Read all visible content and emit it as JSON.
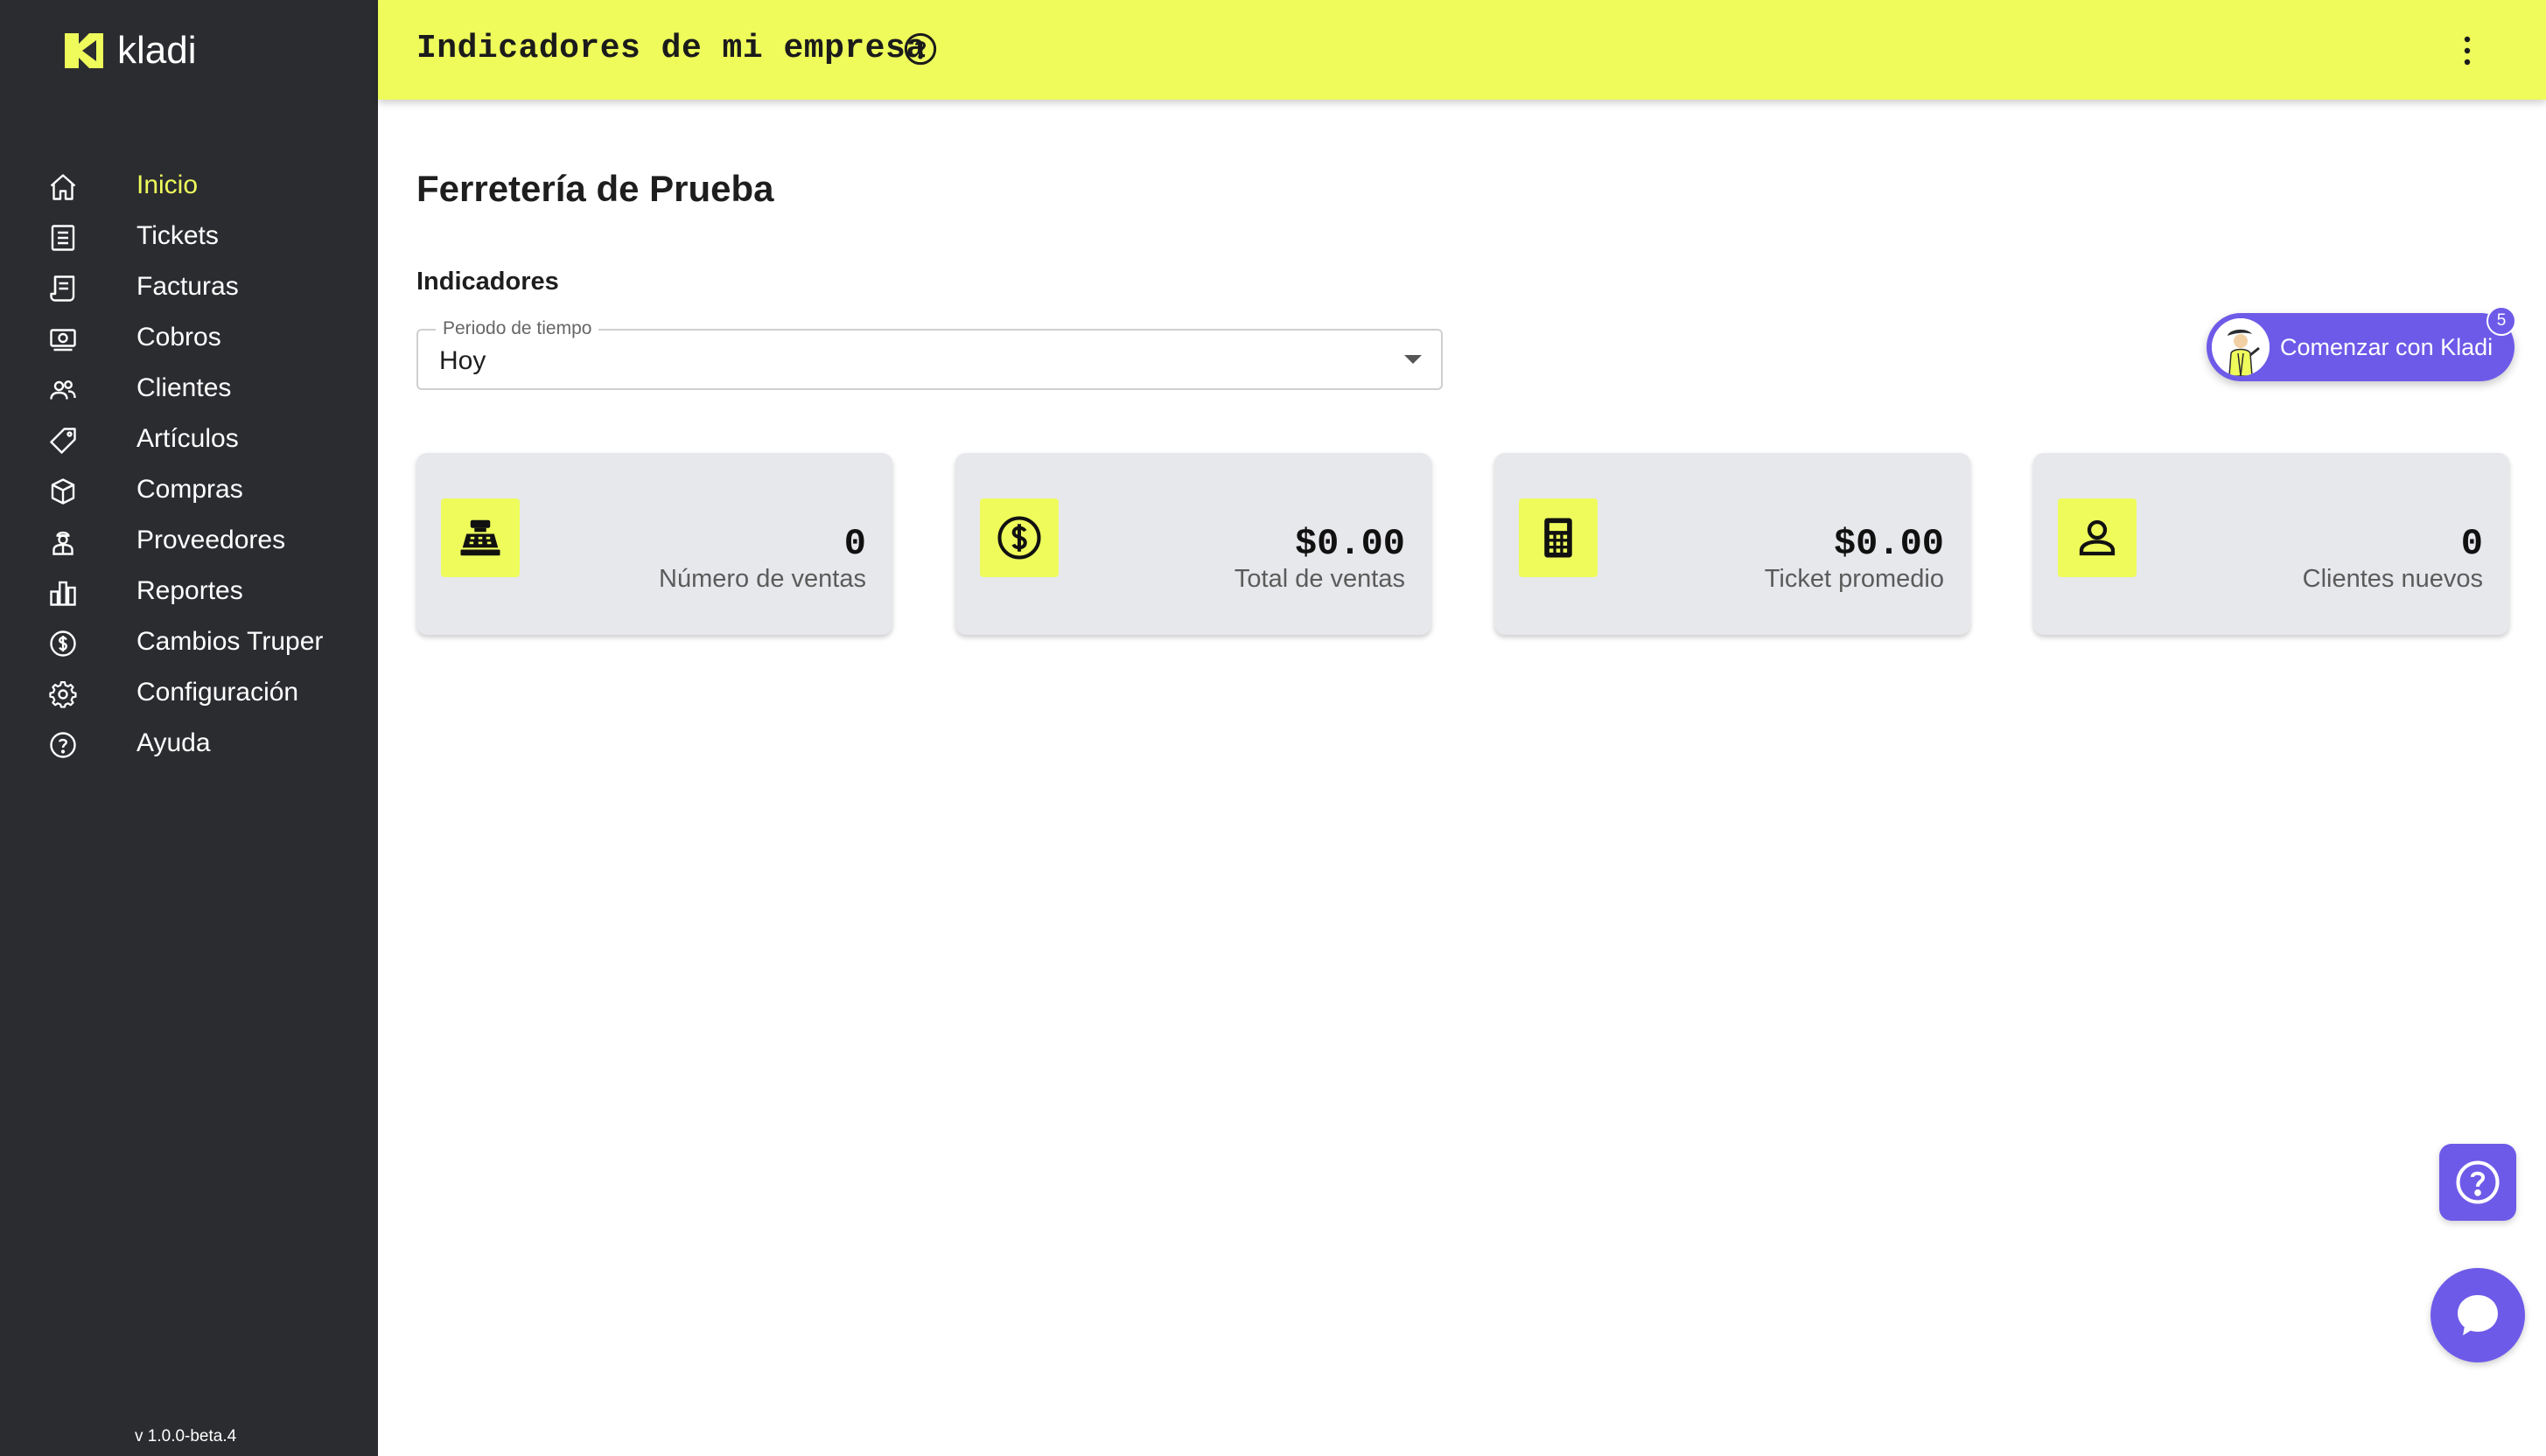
{
  "app": {
    "name": "kladi",
    "version": "v 1.0.0-beta.4"
  },
  "header": {
    "title": "Indicadores de mi empresa"
  },
  "sidebar": {
    "items": [
      {
        "label": "Inicio",
        "icon": "home-icon",
        "active": true
      },
      {
        "label": "Tickets",
        "icon": "receipt-list-icon",
        "active": false
      },
      {
        "label": "Facturas",
        "icon": "invoice-icon",
        "active": false
      },
      {
        "label": "Cobros",
        "icon": "cash-icon",
        "active": false
      },
      {
        "label": "Clientes",
        "icon": "users-icon",
        "active": false
      },
      {
        "label": "Artículos",
        "icon": "tag-icon",
        "active": false
      },
      {
        "label": "Compras",
        "icon": "box-icon",
        "active": false
      },
      {
        "label": "Proveedores",
        "icon": "supplier-icon",
        "active": false
      },
      {
        "label": "Reportes",
        "icon": "bar-chart-icon",
        "active": false
      },
      {
        "label": "Cambios Truper",
        "icon": "exchange-coin-icon",
        "active": false
      },
      {
        "label": "Configuración",
        "icon": "gear-icon",
        "active": false
      },
      {
        "label": "Ayuda",
        "icon": "help-circle-icon",
        "active": false
      }
    ]
  },
  "main": {
    "company": "Ferretería de Prueba",
    "section": "Indicadores",
    "period": {
      "legend": "Periodo de tiempo",
      "value": "Hoy"
    },
    "start_button": {
      "label": "Comenzar con Kladi",
      "badge": "5"
    },
    "cards": [
      {
        "value": "0",
        "label": "Número de ventas",
        "icon": "cash-register-icon"
      },
      {
        "value": "$0.00",
        "label": "Total de ventas",
        "icon": "dollar-circle-icon"
      },
      {
        "value": "$0.00",
        "label": "Ticket promedio",
        "icon": "calculator-icon"
      },
      {
        "value": "0",
        "label": "Clientes nuevos",
        "icon": "person-icon"
      }
    ]
  },
  "colors": {
    "sidebar": "#2b2c30",
    "accent": "#eefb5b",
    "purple": "#6e5ae8",
    "card": "#e7e8ec"
  }
}
